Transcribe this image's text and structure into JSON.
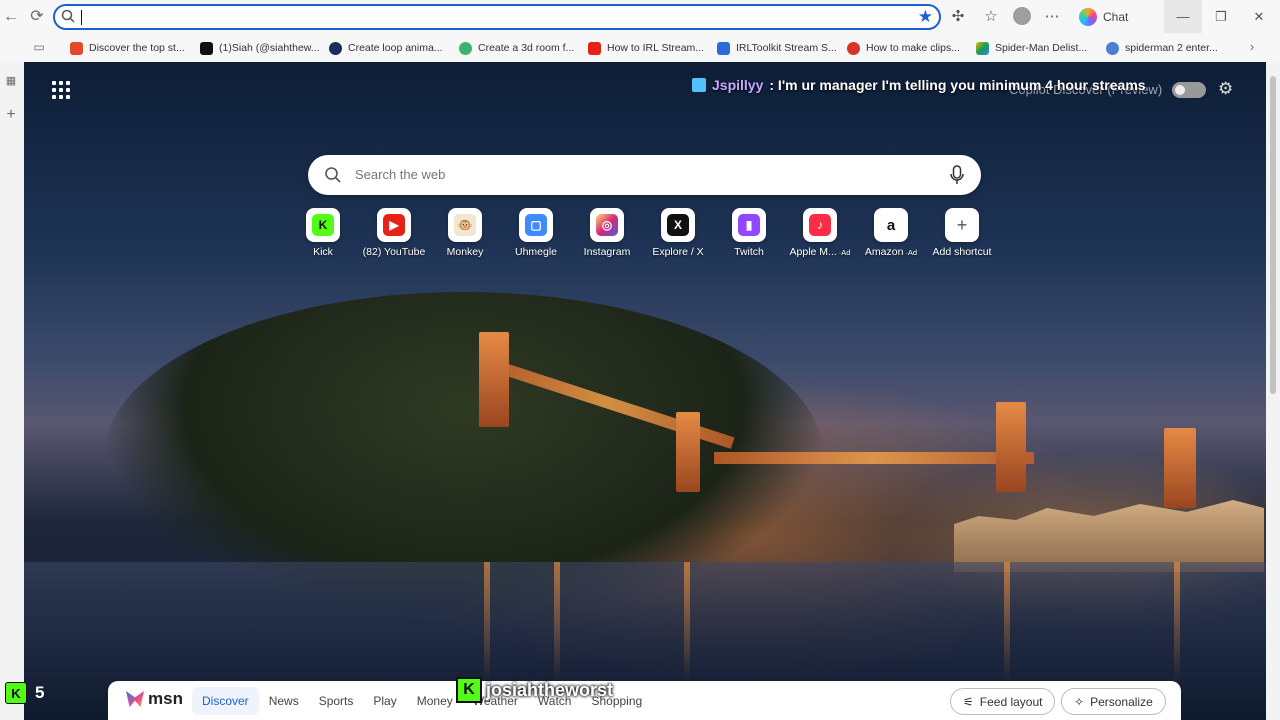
{
  "browser": {
    "address_value": "",
    "chat_label": "Chat"
  },
  "bookmarks": [
    {
      "label": "Discover the top st...",
      "color": "#e24a2a"
    },
    {
      "label": "(1)Siah (@siahthew...",
      "color": "#111111"
    },
    {
      "label": "Create loop anima...",
      "color": "#1c2d5a"
    },
    {
      "label": "Create a 3d room f...",
      "color": "#3bb36a"
    },
    {
      "label": "How to IRL Stream...",
      "color": "#e62117"
    },
    {
      "label": "IRLToolkit Stream S...",
      "color": "#2b6cd8"
    },
    {
      "label": "How to make clips...",
      "color": "#d8342a"
    },
    {
      "label": "Spider-Man Delist...",
      "color": "#f4b400"
    },
    {
      "label": "spiderman 2 enter...",
      "color": "#4a7fd1"
    }
  ],
  "newtab": {
    "copilot_label": "Copilot Discover (Preview)",
    "search_placeholder": "Search the web",
    "shortcuts": [
      {
        "label": "Kick",
        "ad": "",
        "glyph": "K",
        "color": "#53fc18",
        "text_color": "#111111",
        "icon": "kick-icon"
      },
      {
        "label": "(82) YouTube",
        "ad": "",
        "glyph": "▶",
        "color": "#e62117",
        "text_color": "#ffffff",
        "icon": "youtube-icon"
      },
      {
        "label": "Monkey",
        "ad": "",
        "glyph": "🐵",
        "color": "#f2e6d0",
        "text_color": "#111111",
        "icon": "monkey-icon"
      },
      {
        "label": "Uhmegle",
        "ad": "",
        "glyph": "▢",
        "color": "#3d8bfd",
        "text_color": "#ffffff",
        "icon": "uhmegle-icon"
      },
      {
        "label": "Instagram",
        "ad": "",
        "glyph": "◎",
        "color": "#d62976",
        "text_color": "#ffffff",
        "icon": "instagram-icon"
      },
      {
        "label": "Explore / X",
        "ad": "",
        "glyph": "X",
        "color": "#111111",
        "text_color": "#ffffff",
        "icon": "x-icon"
      },
      {
        "label": "Twitch",
        "ad": "",
        "glyph": "▮",
        "color": "#9146ff",
        "text_color": "#ffffff",
        "icon": "twitch-icon"
      },
      {
        "label": "Apple M...",
        "ad": "Ad",
        "glyph": "♪",
        "color": "#fa2d48",
        "text_color": "#ffffff",
        "icon": "apple-music-icon"
      },
      {
        "label": "Amazon",
        "ad": "Ad",
        "glyph": "a",
        "color": "#ffffff",
        "text_color": "#111111",
        "icon": "amazon-icon"
      },
      {
        "label": "Add shortcut",
        "ad": "",
        "glyph": "+",
        "color": "#ffffff",
        "text_color": "#555555",
        "icon": "add-icon"
      }
    ]
  },
  "stream_overlay": {
    "username": "Jspillyy",
    "message": ": I'm ur manager I'm telling you minimum 4 hour streams",
    "watermark": "josiahtheworst",
    "viewer_count": "5"
  },
  "msn_bar": {
    "brand": "msn",
    "tabs": [
      "Discover",
      "News",
      "Sports",
      "Play",
      "Money",
      "Weather",
      "Watch",
      "Shopping"
    ],
    "active_tab": "Discover",
    "feed_layout": "Feed layout",
    "personalize": "Personalize"
  }
}
